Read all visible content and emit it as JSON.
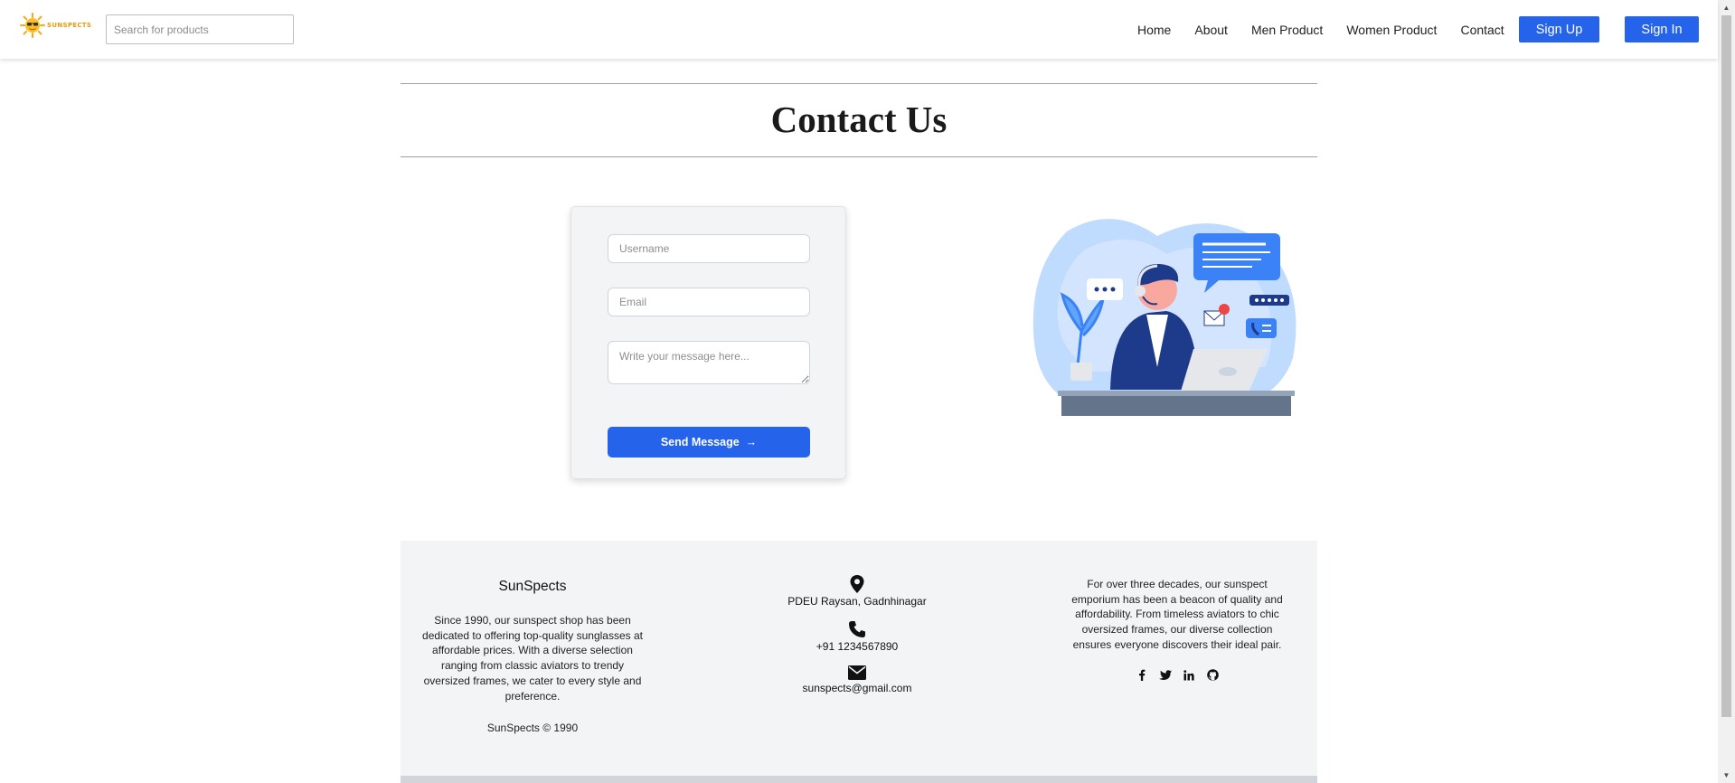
{
  "brand": {
    "logo_text": "SUNSPECTS"
  },
  "search": {
    "placeholder": "Search for products"
  },
  "nav": {
    "items": [
      {
        "label": "Home"
      },
      {
        "label": "About"
      },
      {
        "label": "Men Product"
      },
      {
        "label": "Women Product"
      },
      {
        "label": "Contact"
      }
    ],
    "signup_label": "Sign Up",
    "signin_label": "Sign In"
  },
  "page": {
    "title": "Contact Us"
  },
  "form": {
    "username_placeholder": "Username",
    "email_placeholder": "Email",
    "message_placeholder": "Write your message here...",
    "send_label": "Send Message",
    "send_arrow": "→"
  },
  "footer": {
    "about": {
      "title": "SunSpects",
      "text": "Since 1990, our sunspect shop has been dedicated to offering top-quality sunglasses at affordable prices. With a diverse selection ranging from classic aviators to trendy oversized frames, we cater to every style and preference.",
      "copyright": "SunSpects © 1990"
    },
    "contact": {
      "address": "PDEU Raysan, Gadnhinagar",
      "phone": "+91 1234567890",
      "email": "sunspects@gmail.com"
    },
    "blurb": "For over three decades, our sunspect emporium has been a beacon of quality and affordability. From timeless aviators to chic oversized frames, our diverse collection ensures everyone discovers their ideal pair.",
    "socials": [
      "facebook-icon",
      "twitter-icon",
      "linkedin-icon",
      "github-icon"
    ]
  },
  "colors": {
    "primary": "#2563eb",
    "footer_bg": "#f3f4f6",
    "logo_orange": "#e89a0c"
  }
}
